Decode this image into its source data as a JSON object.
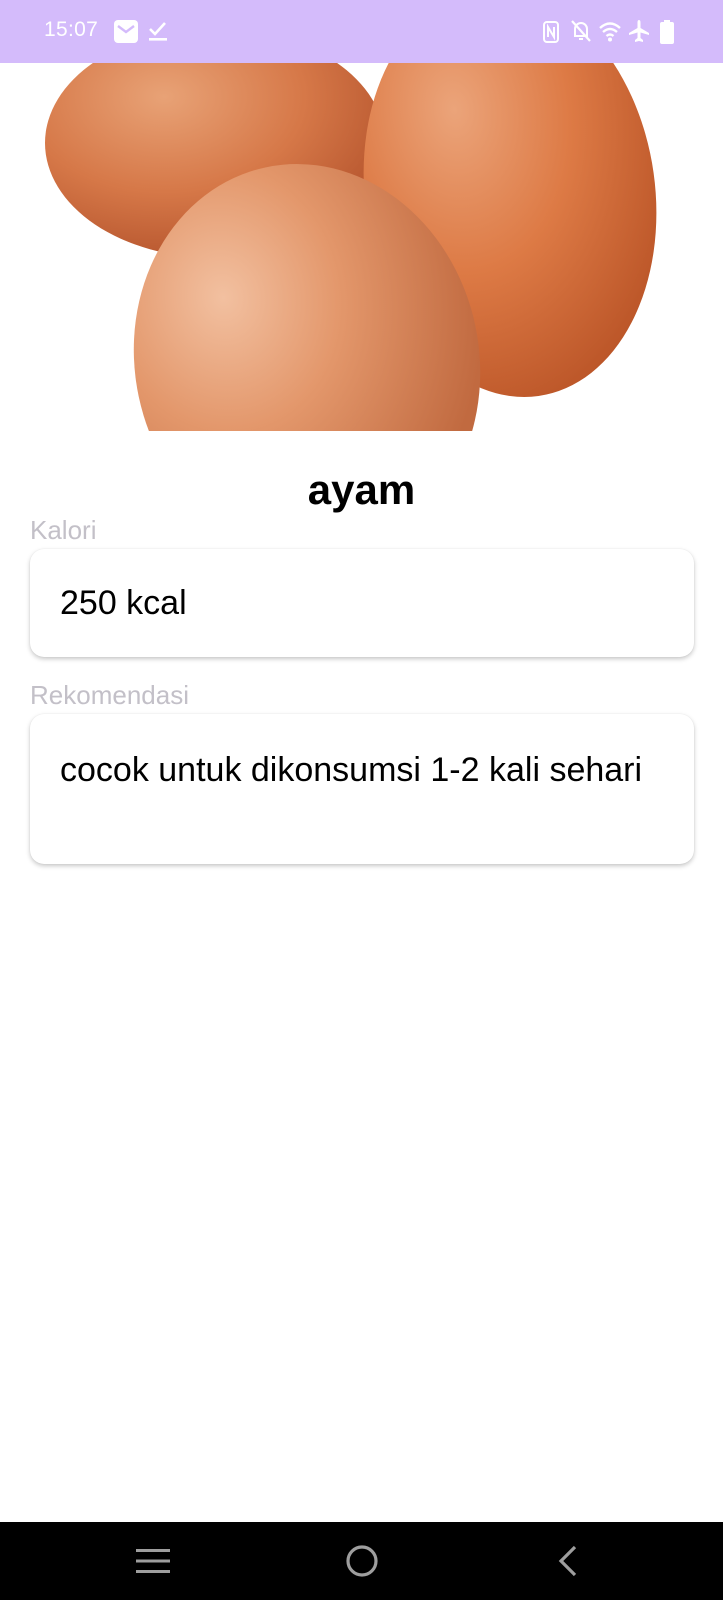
{
  "status_bar": {
    "time": "15:07",
    "background": "#d4bbfb",
    "left_icons": [
      "gmail-icon",
      "download-done-icon"
    ],
    "right_icons": [
      "nfc-icon",
      "notifications-off-icon",
      "wifi-icon",
      "airplane-icon",
      "battery-icon"
    ]
  },
  "food": {
    "name": "ayam",
    "image": "eggs-photo"
  },
  "kalori": {
    "label": "Kalori",
    "value": "250 kcal"
  },
  "rekomendasi": {
    "label": "Rekomendasi",
    "value": "cocok untuk dikonsumsi 1-2 kali sehari"
  },
  "nav_bar": {
    "buttons": [
      "menu-icon",
      "home-icon",
      "back-icon"
    ]
  }
}
